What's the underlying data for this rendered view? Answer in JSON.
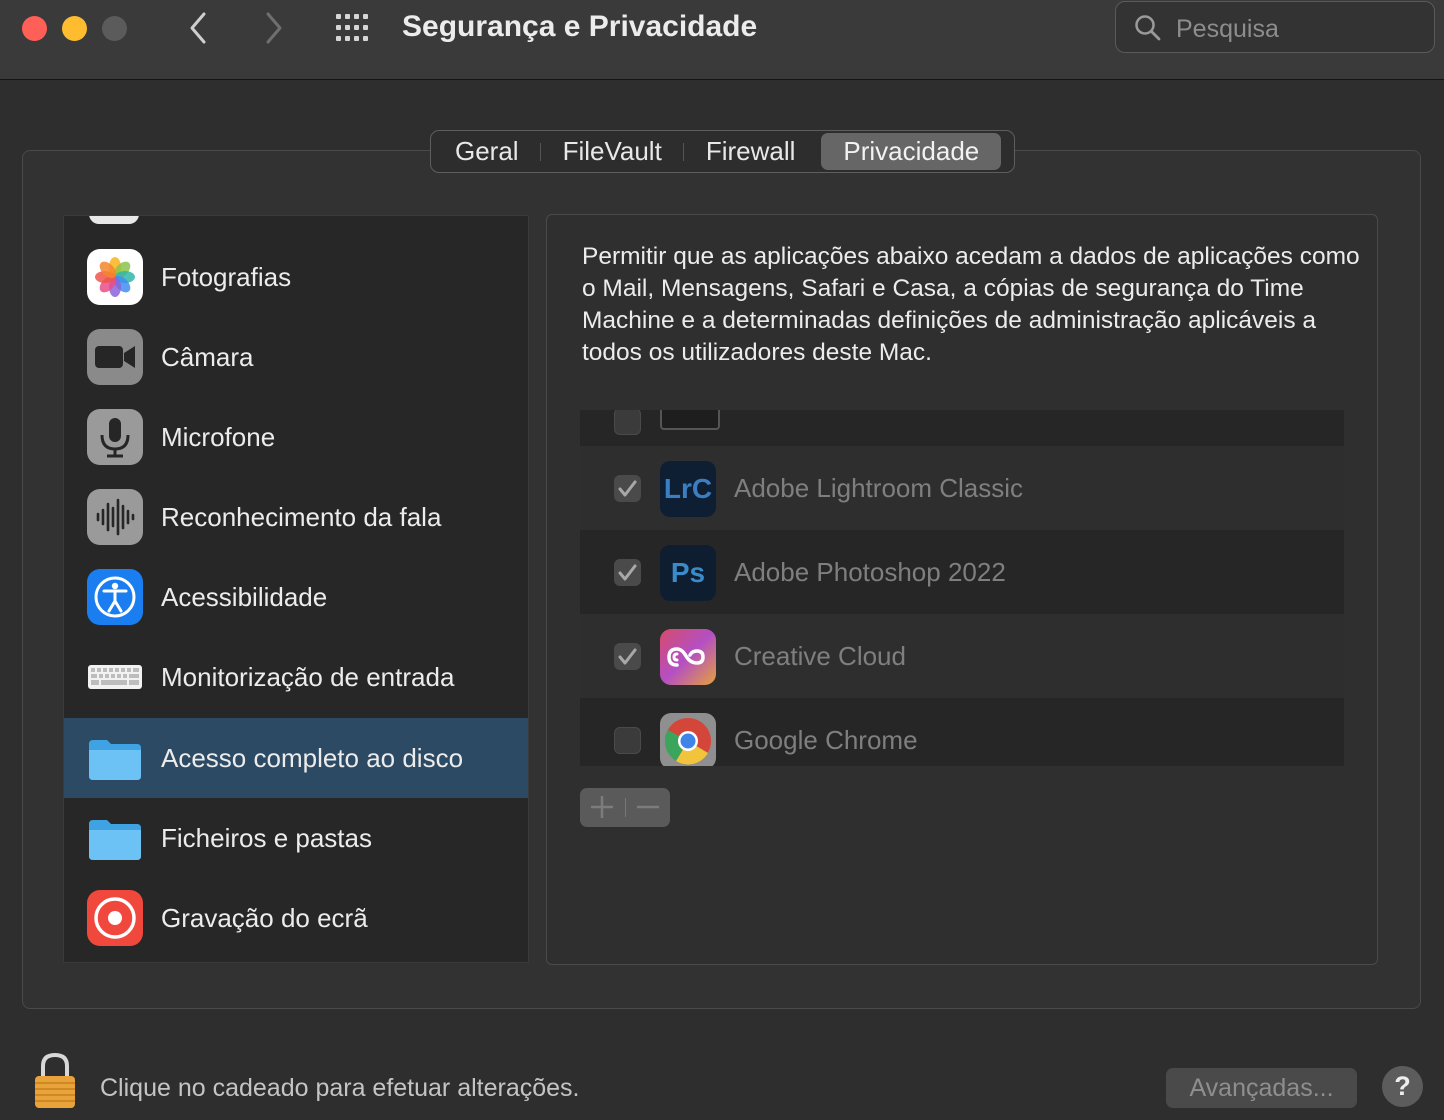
{
  "window": {
    "title": "Segurança e Privacidade",
    "search_placeholder": "Pesquisa"
  },
  "tabs": [
    {
      "label": "Geral"
    },
    {
      "label": "FileVault"
    },
    {
      "label": "Firewall"
    },
    {
      "label": "Privacidade",
      "active": true
    }
  ],
  "sidebar": {
    "items": [
      {
        "label": "Fotografias",
        "icon": "photos-icon"
      },
      {
        "label": "Câmara",
        "icon": "camera-icon"
      },
      {
        "label": "Microfone",
        "icon": "microphone-icon"
      },
      {
        "label": "Reconhecimento da fala",
        "icon": "speech-recognition-icon"
      },
      {
        "label": "Acessibilidade",
        "icon": "accessibility-icon"
      },
      {
        "label": "Monitorização de entrada",
        "icon": "keyboard-icon"
      },
      {
        "label": "Acesso completo ao disco",
        "icon": "folder-icon",
        "selected": true
      },
      {
        "label": "Ficheiros e pastas",
        "icon": "folder-icon"
      },
      {
        "label": "Gravação do ecrã",
        "icon": "screen-recording-icon"
      }
    ]
  },
  "content": {
    "description": "Permitir que as aplicações abaixo acedam a dados de aplicações como o Mail, Mensagens, Safari e Casa, a cópias de segurança do Time Machine e a determinadas definições de administração aplicáveis a todos os utilizadores deste Mac.",
    "apps": [
      {
        "name": "Adobe Lightroom Classic",
        "checked": true,
        "icon": "lightroom-icon",
        "icon_text": "LrC"
      },
      {
        "name": "Adobe Photoshop 2022",
        "checked": true,
        "icon": "photoshop-icon",
        "icon_text": "Ps"
      },
      {
        "name": "Creative Cloud",
        "checked": true,
        "icon": "creative-cloud-icon"
      },
      {
        "name": "Google Chrome",
        "checked": false,
        "icon": "chrome-icon"
      }
    ]
  },
  "footer": {
    "lock_text": "Clique no cadeado para efetuar alterações.",
    "advanced_label": "Avançadas...",
    "help_label": "?"
  },
  "colors": {
    "selection": "#2d4a64",
    "close": "#fe5f57",
    "minimize": "#febc2e"
  }
}
